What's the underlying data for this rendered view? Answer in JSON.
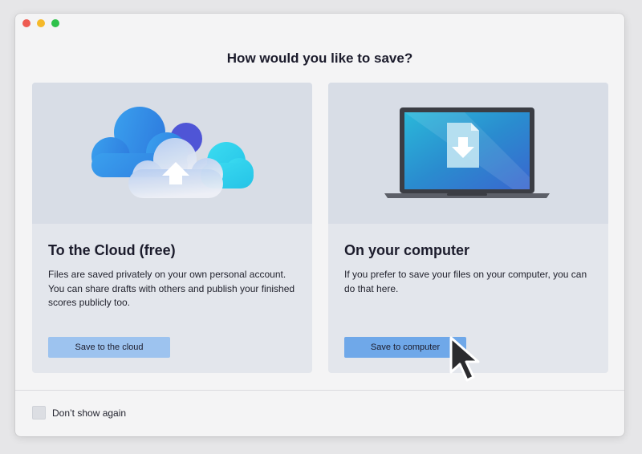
{
  "dialog": {
    "title": "How would you like to save?"
  },
  "options": {
    "cloud": {
      "title": "To the Cloud (free)",
      "description": "Files are saved privately on your own personal account. You can share drafts with others and publish your finished scores publicly too.",
      "button_label": "Save to the cloud",
      "illustration_icon": "cloud-upload-icon"
    },
    "computer": {
      "title": "On your computer",
      "description": "If you prefer to save your files on your computer, you can do that here.",
      "button_label": "Save to computer",
      "illustration_icon": "laptop-download-icon"
    }
  },
  "footer": {
    "checkbox_label": "Don’t show again",
    "checked": false
  },
  "colors": {
    "accent_button": "#6fa8e9",
    "light_button": "#9dc3ef",
    "close": "#ee5b52",
    "minimize": "#f5b92a",
    "maximize": "#2ec14a"
  }
}
